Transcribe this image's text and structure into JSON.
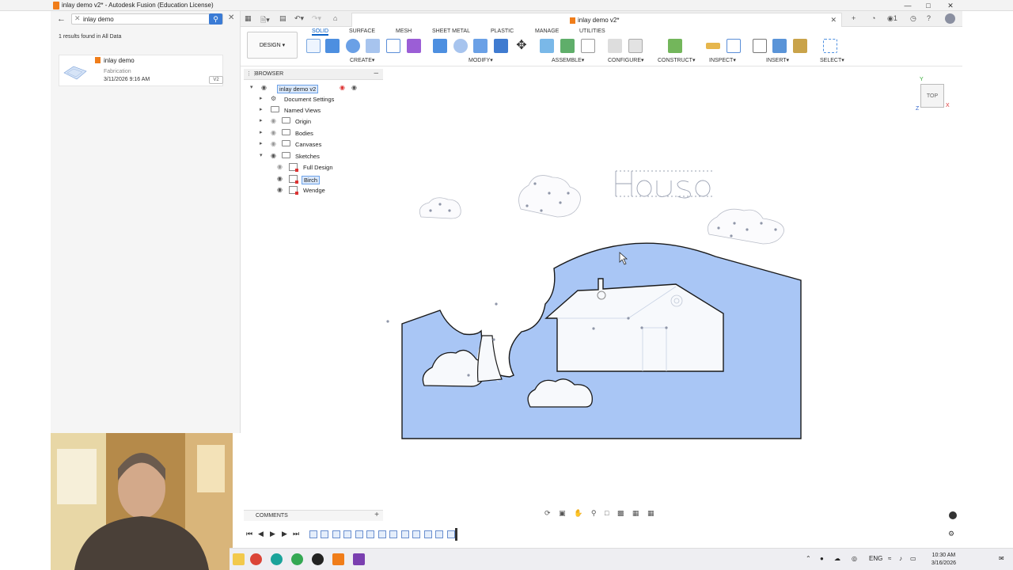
{
  "window": {
    "title": "inlay demo v2* - Autodesk Fusion (Education License)"
  },
  "data_panel": {
    "search_value": "inlay demo",
    "results_text": "1 results found in All Data",
    "result": {
      "name": "inlay demo",
      "project": "Fabrication",
      "date": "3/11/2026 9:16 AM",
      "version": "V2"
    }
  },
  "doc_tab": {
    "label": "inlay demo v2*"
  },
  "toolbar": {
    "workspace": "DESIGN",
    "tabs": [
      "SOLID",
      "SURFACE",
      "MESH",
      "SHEET METAL",
      "PLASTIC",
      "MANAGE",
      "UTILITIES"
    ],
    "active_tab": "SOLID",
    "groups": [
      "CREATE",
      "MODIFY",
      "ASSEMBLE",
      "CONFIGURE",
      "CONSTRUCT",
      "INSPECT",
      "INSERT",
      "SELECT"
    ]
  },
  "browser": {
    "title": "BROWSER",
    "root": "inlay demo v2",
    "items": [
      {
        "label": "Document Settings"
      },
      {
        "label": "Named Views"
      },
      {
        "label": "Origin"
      },
      {
        "label": "Bodies"
      },
      {
        "label": "Canvases"
      },
      {
        "label": "Sketches"
      }
    ],
    "sketches": [
      "Full Design",
      "Birch",
      "Wendge"
    ]
  },
  "viewcube": {
    "face": "TOP",
    "x": "X",
    "y": "Y",
    "z": "Z"
  },
  "comments": {
    "label": "COMMENTS"
  },
  "taskbar": {
    "language": "ENG",
    "time": "10:30 AM",
    "date": "3/16/2026"
  },
  "colors": {
    "accent": "#0b62c7",
    "sketch_fill": "#a9c6f5",
    "app_orange": "#f07d1a"
  }
}
